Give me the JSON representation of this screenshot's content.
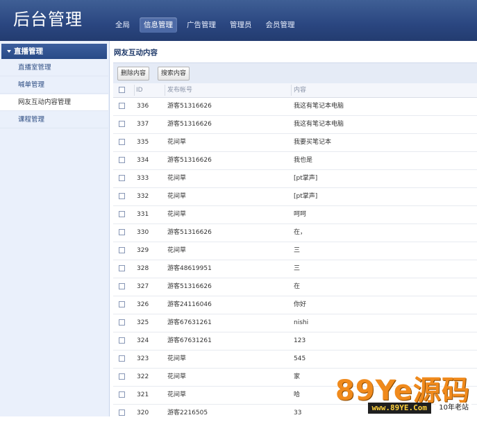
{
  "header": {
    "brand": "后台管理",
    "tabs": [
      {
        "label": "全局"
      },
      {
        "label": "信息管理"
      },
      {
        "label": "广告管理"
      },
      {
        "label": "管理员"
      },
      {
        "label": "会员管理"
      }
    ]
  },
  "sidebar": {
    "section_label": "直播管理",
    "items": [
      {
        "label": "直播室管理"
      },
      {
        "label": "喊单管理"
      },
      {
        "label": "网友互动内容管理"
      },
      {
        "label": "课程管理"
      }
    ]
  },
  "main": {
    "title": "网友互动内容",
    "toolbar": {
      "delete_label": "删除内容",
      "search_label": "搜索内容"
    },
    "columns": {
      "id": "ID",
      "account": "发布帐号",
      "content": "内容"
    },
    "rows": [
      {
        "id": "336",
        "account": "游客51316626",
        "content": "我这有笔记本电脑"
      },
      {
        "id": "337",
        "account": "游客51316626",
        "content": "我这有笔记本电脑"
      },
      {
        "id": "335",
        "account": "花间草",
        "content": "我要买笔记本"
      },
      {
        "id": "334",
        "account": "游客51316626",
        "content": "我也是"
      },
      {
        "id": "333",
        "account": "花间草",
        "content": "[pt掌声]"
      },
      {
        "id": "332",
        "account": "花间草",
        "content": "[pt掌声]"
      },
      {
        "id": "331",
        "account": "花间草",
        "content": "呵呵"
      },
      {
        "id": "330",
        "account": "游客51316626",
        "content": "在，"
      },
      {
        "id": "329",
        "account": "花间草",
        "content": "三"
      },
      {
        "id": "328",
        "account": "游客48619951",
        "content": "三"
      },
      {
        "id": "327",
        "account": "游客51316626",
        "content": "在"
      },
      {
        "id": "326",
        "account": "游客24116046",
        "content": "你好"
      },
      {
        "id": "325",
        "account": "游客67631261",
        "content": "nishi"
      },
      {
        "id": "324",
        "account": "游客67631261",
        "content": "123"
      },
      {
        "id": "323",
        "account": "花间草",
        "content": "545"
      },
      {
        "id": "322",
        "account": "花间草",
        "content": "家"
      },
      {
        "id": "321",
        "account": "花间草",
        "content": "哈"
      },
      {
        "id": "320",
        "account": "游客2216505",
        "content": "33"
      }
    ]
  },
  "watermark": {
    "big": "89Ye源码",
    "url": "www.89YE.Com",
    "tag": "10年老站"
  },
  "colors": {
    "header": "#2a4680",
    "sidebar_bg": "#eaf0fb",
    "accent_orange": "#f08a1c"
  }
}
